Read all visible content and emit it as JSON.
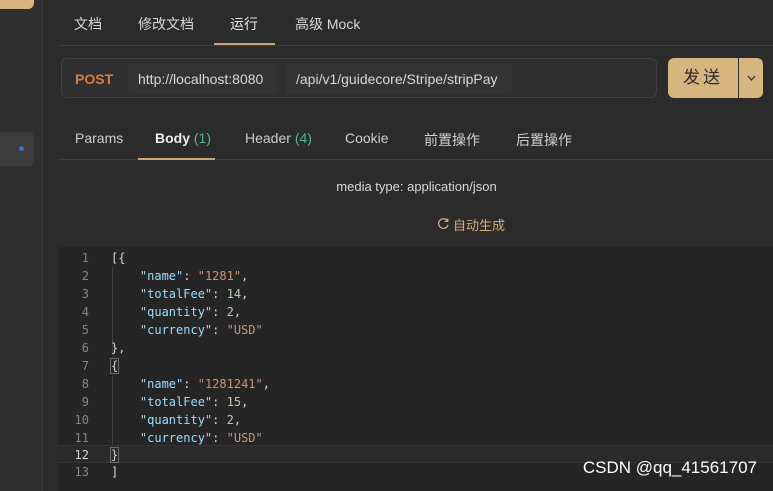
{
  "top_tabs": [
    "文档",
    "修改文档",
    "运行",
    "高级 Mock"
  ],
  "request": {
    "method": "POST",
    "host": "http://localhost:8080",
    "path": "/api/v1/guidecore/Stripe/stripPay",
    "send_label": "发送"
  },
  "sub_tabs": {
    "params": "Params",
    "body": "Body",
    "body_count": "(1)",
    "header": "Header",
    "header_count": "(4)",
    "cookie": "Cookie",
    "pre": "前置操作",
    "post": "后置操作"
  },
  "media_type": "media type: application/json",
  "autogen": "自动生成",
  "code": {
    "line_numbers": [
      "1",
      "2",
      "3",
      "4",
      "5",
      "6",
      "7",
      "8",
      "9",
      "10",
      "11",
      "12",
      "13"
    ],
    "current_line": 12
  },
  "items": [
    {
      "name": "1281",
      "totalFee": "14",
      "quantity": "2",
      "currency": "USD"
    },
    {
      "name": "1281241",
      "totalFee": "15",
      "quantity": "2",
      "currency": "USD"
    }
  ],
  "watermark": "CSDN @qq_41561707",
  "colors": {
    "accent": "#d7b57f",
    "method": "#e07b39",
    "count": "#4fb98a",
    "json_key": "#9cdcfe",
    "json_string": "#ce9178",
    "json_number": "#b5cea8"
  }
}
